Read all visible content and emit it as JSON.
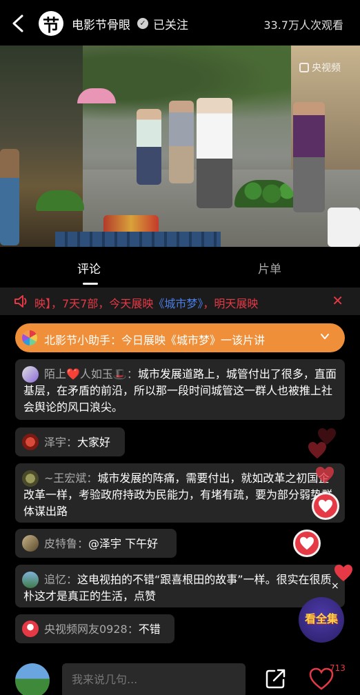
{
  "topbar": {
    "channel_logo": "节",
    "channel_name": "电影节骨眼",
    "followed": "已关注",
    "viewers": "33.7万人次观看",
    "icons": {
      "back": "back-arrow-icon",
      "verified": "verified-check-icon"
    }
  },
  "video": {
    "watermark": "央视频"
  },
  "tabs": [
    {
      "label": "评论",
      "active": true
    },
    {
      "label": "片单",
      "active": false
    }
  ],
  "announcement": {
    "text_prefix": "映】，7天7部，今天展映",
    "title1": "《城市梦》",
    "text_mid": "，明天展映",
    "close": "✕",
    "color": "#e63946",
    "link_color": "#4a7ee8"
  },
  "helper": {
    "text": "北影节小助手：今日展映《城市梦》一该片讲",
    "color": "#ef8f3a"
  },
  "comments": [
    {
      "name": "陌上❤️人如玉🎩：",
      "text": "城市发展道路上，城管付出了很多，直面基层，在矛盾的前沿，所以那一段时间城管这一群人也被推上社会舆论的风口浪尖。"
    },
    {
      "name": "泽宇：",
      "text": "大家好"
    },
    {
      "name": "~王宏斌：",
      "text": "城市发展的阵痛，需要付出，就如改革之初国企改革一样，考验政府持政为民能力，有堵有疏，要为部分弱势群体谋出路"
    },
    {
      "name": "皮特鲁：",
      "text": "@泽宇 下午好"
    },
    {
      "name": "追忆：",
      "text": "这电视拍的不错“跟喜根田的故事”一样。很实在很质朴这才是真正的生活，点赞"
    },
    {
      "name": "央视频网友0928：",
      "text": "不错"
    }
  ],
  "floating": {
    "watch_all": "看全集",
    "close": "×"
  },
  "bottombar": {
    "placeholder": "我来说几句...",
    "like_count": "713"
  }
}
